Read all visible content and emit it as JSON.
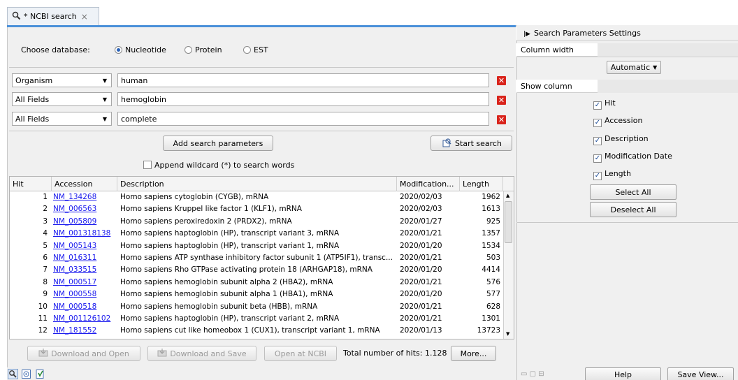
{
  "tab": {
    "title": "* NCBI search",
    "close": "×",
    "icon": "search-icon"
  },
  "database": {
    "label": "Choose database:",
    "options": [
      "Nucleotide",
      "Protein",
      "EST"
    ],
    "selected": "Nucleotide"
  },
  "filters": [
    {
      "field": "Organism",
      "value": "human"
    },
    {
      "field": "All Fields",
      "value": "hemoglobin"
    },
    {
      "field": "All Fields",
      "value": "complete"
    }
  ],
  "buttons": {
    "add_params": "Add search parameters",
    "start_search": "Start search",
    "download_open": "Download and Open",
    "download_save": "Download and Save",
    "open_ncbi": "Open at NCBI",
    "more": "More..."
  },
  "wildcard_label": "Append wildcard (*) to search words",
  "table": {
    "columns": [
      "Hit",
      "Accession",
      "Description",
      "Modification...",
      "Length"
    ],
    "rows": [
      [
        "1",
        "NM_134268",
        "Homo sapiens cytoglobin (CYGB), mRNA",
        "2020/02/03",
        "1962"
      ],
      [
        "2",
        "NM_006563",
        "Homo sapiens Kruppel like factor 1 (KLF1), mRNA",
        "2020/02/03",
        "1613"
      ],
      [
        "3",
        "NM_005809",
        "Homo sapiens peroxiredoxin 2 (PRDX2), mRNA",
        "2020/01/27",
        "925"
      ],
      [
        "4",
        "NM_001318138",
        "Homo sapiens haptoglobin (HP), transcript variant 3, mRNA",
        "2020/01/21",
        "1357"
      ],
      [
        "5",
        "NM_005143",
        "Homo sapiens haptoglobin (HP), transcript variant 1, mRNA",
        "2020/01/20",
        "1534"
      ],
      [
        "6",
        "NM_016311",
        "Homo sapiens ATP synthase inhibitory factor subunit 1 (ATP5IF1), transc...",
        "2020/01/21",
        "503"
      ],
      [
        "7",
        "NM_033515",
        "Homo sapiens Rho GTPase activating protein 18 (ARHGAP18), mRNA",
        "2020/01/20",
        "4414"
      ],
      [
        "8",
        "NM_000517",
        "Homo sapiens hemoglobin subunit alpha 2 (HBA2), mRNA",
        "2020/01/21",
        "576"
      ],
      [
        "9",
        "NM_000558",
        "Homo sapiens hemoglobin subunit alpha 1 (HBA1), mRNA",
        "2020/01/20",
        "577"
      ],
      [
        "10",
        "NM_000518",
        "Homo sapiens hemoglobin subunit beta (HBB), mRNA",
        "2020/01/21",
        "628"
      ],
      [
        "11",
        "NM_001126102",
        "Homo sapiens haptoglobin (HP), transcript variant 2, mRNA",
        "2020/01/21",
        "1301"
      ],
      [
        "12",
        "NM_181552",
        "Homo sapiens cut like homeobox 1 (CUX1), transcript variant 1, mRNA",
        "2020/01/13",
        "13723"
      ]
    ]
  },
  "total_hits": "Total number of hits: 1.128",
  "settings": {
    "title": "Search Parameters Settings",
    "column_width_label": "Column width",
    "column_width_value": "Automatic",
    "show_column_label": "Show column",
    "columns": [
      "Hit",
      "Accession",
      "Description",
      "Modification Date",
      "Length"
    ],
    "select_all": "Select All",
    "deselect_all": "Deselect All",
    "help": "Help",
    "save_view": "Save View..."
  }
}
